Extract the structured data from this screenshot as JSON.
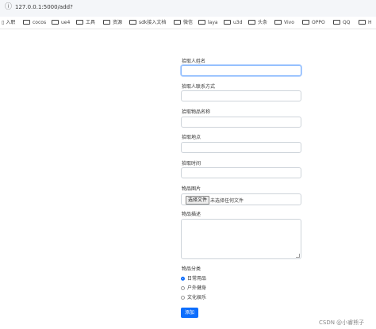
{
  "browser": {
    "url": "127.0.0.1:5000/add?",
    "bookmarks": [
      "入职",
      "cocos",
      "ue4",
      "工具",
      "资源",
      "sdk接入文档",
      "微信",
      "laya",
      "u3d",
      "头条",
      "Vivo",
      "OPPO",
      "QQ",
      "H"
    ]
  },
  "form": {
    "picker_name_label": "拾取人姓名",
    "picker_contact_label": "拾取人联系方式",
    "item_name_label": "拾取物品名称",
    "pickup_place_label": "拾取地点",
    "pickup_time_label": "拾取时间",
    "item_image_label": "物品图片",
    "choose_file_label": "选择文件",
    "no_file_text": "未选择任何文件",
    "item_desc_label": "物品描述",
    "category_label": "物品分类",
    "categories": [
      "日常用品",
      "户外健身",
      "文化娱乐"
    ],
    "selected_category": "日常用品",
    "submit_label": "添加"
  },
  "watermark": "CSDN @小睿熊子",
  "colors": {
    "accent": "#0d6efd"
  }
}
